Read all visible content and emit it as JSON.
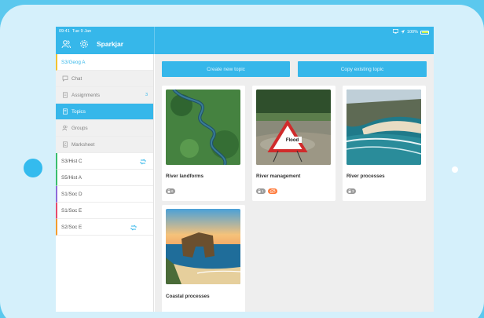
{
  "status": {
    "time": "09:41",
    "date": "Tue 9 Jan",
    "battery": "100%"
  },
  "app": {
    "title": "Sparkjar"
  },
  "sidebar": {
    "selected_class": {
      "label": "S3/Geog A",
      "color": "#f3c230"
    },
    "sub_items": [
      {
        "label": "Chat",
        "icon": "chat-icon"
      },
      {
        "label": "Assignments",
        "icon": "document-icon",
        "count": "3"
      },
      {
        "label": "Topics",
        "icon": "book-icon",
        "active": true
      },
      {
        "label": "Groups",
        "icon": "people-icon"
      },
      {
        "label": "Marksheet",
        "icon": "spreadsheet-icon"
      }
    ],
    "classes": [
      {
        "label": "S3/Hist C",
        "color": "#3bbf6c",
        "icon": "sync-icon"
      },
      {
        "label": "S5/Hist A",
        "color": "#3bbf6c"
      },
      {
        "label": "S1/Soc D",
        "color": "#8e6bd8"
      },
      {
        "label": "S1/Soc E",
        "color": "#e74c6b"
      },
      {
        "label": "S2/Soc E",
        "color": "#f39c2e",
        "icon": "sync-icon"
      }
    ]
  },
  "main": {
    "create_button": "Create new topic",
    "copy_button": "Copy existing topic",
    "topics": [
      {
        "title": "River landforms",
        "badges": [
          {
            "text": "6",
            "icon": "lock-icon"
          }
        ]
      },
      {
        "title": "River management",
        "badges": [
          {
            "text": "1",
            "icon": "lock-icon"
          },
          {
            "text": "",
            "icon": "eye-off-icon",
            "color": "#ff7a3a"
          }
        ]
      },
      {
        "title": "River processes",
        "badges": [
          {
            "text": "3",
            "icon": "lock-icon"
          }
        ]
      },
      {
        "title": "Coastal processes",
        "badges": []
      }
    ]
  },
  "colors": {
    "accent": "#36b7ea",
    "background": "#5bc8ee",
    "frame": "#d5f0fb"
  }
}
